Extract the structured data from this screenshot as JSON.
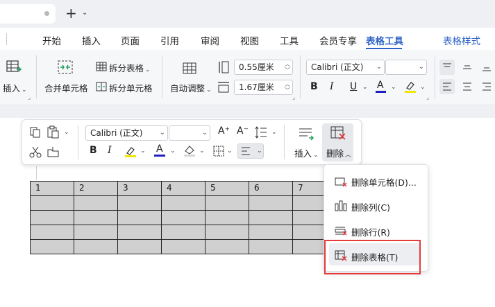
{
  "tabs": {
    "new_tab": "+",
    "new_tab_chevron": "⌄"
  },
  "menu": {
    "items": [
      "开始",
      "插入",
      "页面",
      "引用",
      "审阅",
      "视图",
      "工具",
      "会员专享",
      "表格工具",
      "表格样式"
    ],
    "active": "表格工具"
  },
  "ribbon": {
    "insert_label": "插入",
    "merge_cells": "合并单元格",
    "split_table": "拆分表格",
    "split_cells": "拆分单元格",
    "autofit": "自动调整",
    "row_height": "0.55厘米",
    "col_width": "1.67厘米",
    "font_name": "Calibri (正文)",
    "font_size": "",
    "bold": "B",
    "italic": "I",
    "underline": "U",
    "font_color_letter": "A"
  },
  "mini_toolbar": {
    "font_name": "Calibri (正文)",
    "font_size": "",
    "bold": "B",
    "italic": "I",
    "font_color_letter": "A",
    "grow_font": "A⁺",
    "shrink_font": "A⁻",
    "insert_label": "插入",
    "delete_label": "删除"
  },
  "table": {
    "headers": [
      "1",
      "2",
      "3",
      "4",
      "5",
      "6",
      "7"
    ],
    "row_count": 5
  },
  "dropdown": {
    "items": [
      "删除单元格(D)...",
      "删除列(C)",
      "删除行(R)",
      "删除表格(T)"
    ],
    "highlighted": "删除表格(T)"
  },
  "colors": {
    "accent": "#2b62c7",
    "highlight_box": "#e5393b",
    "table_fill": "#d0d0d0",
    "font_color_bar": "#1f1fbf",
    "highlighter_bar": "#f2e600"
  }
}
